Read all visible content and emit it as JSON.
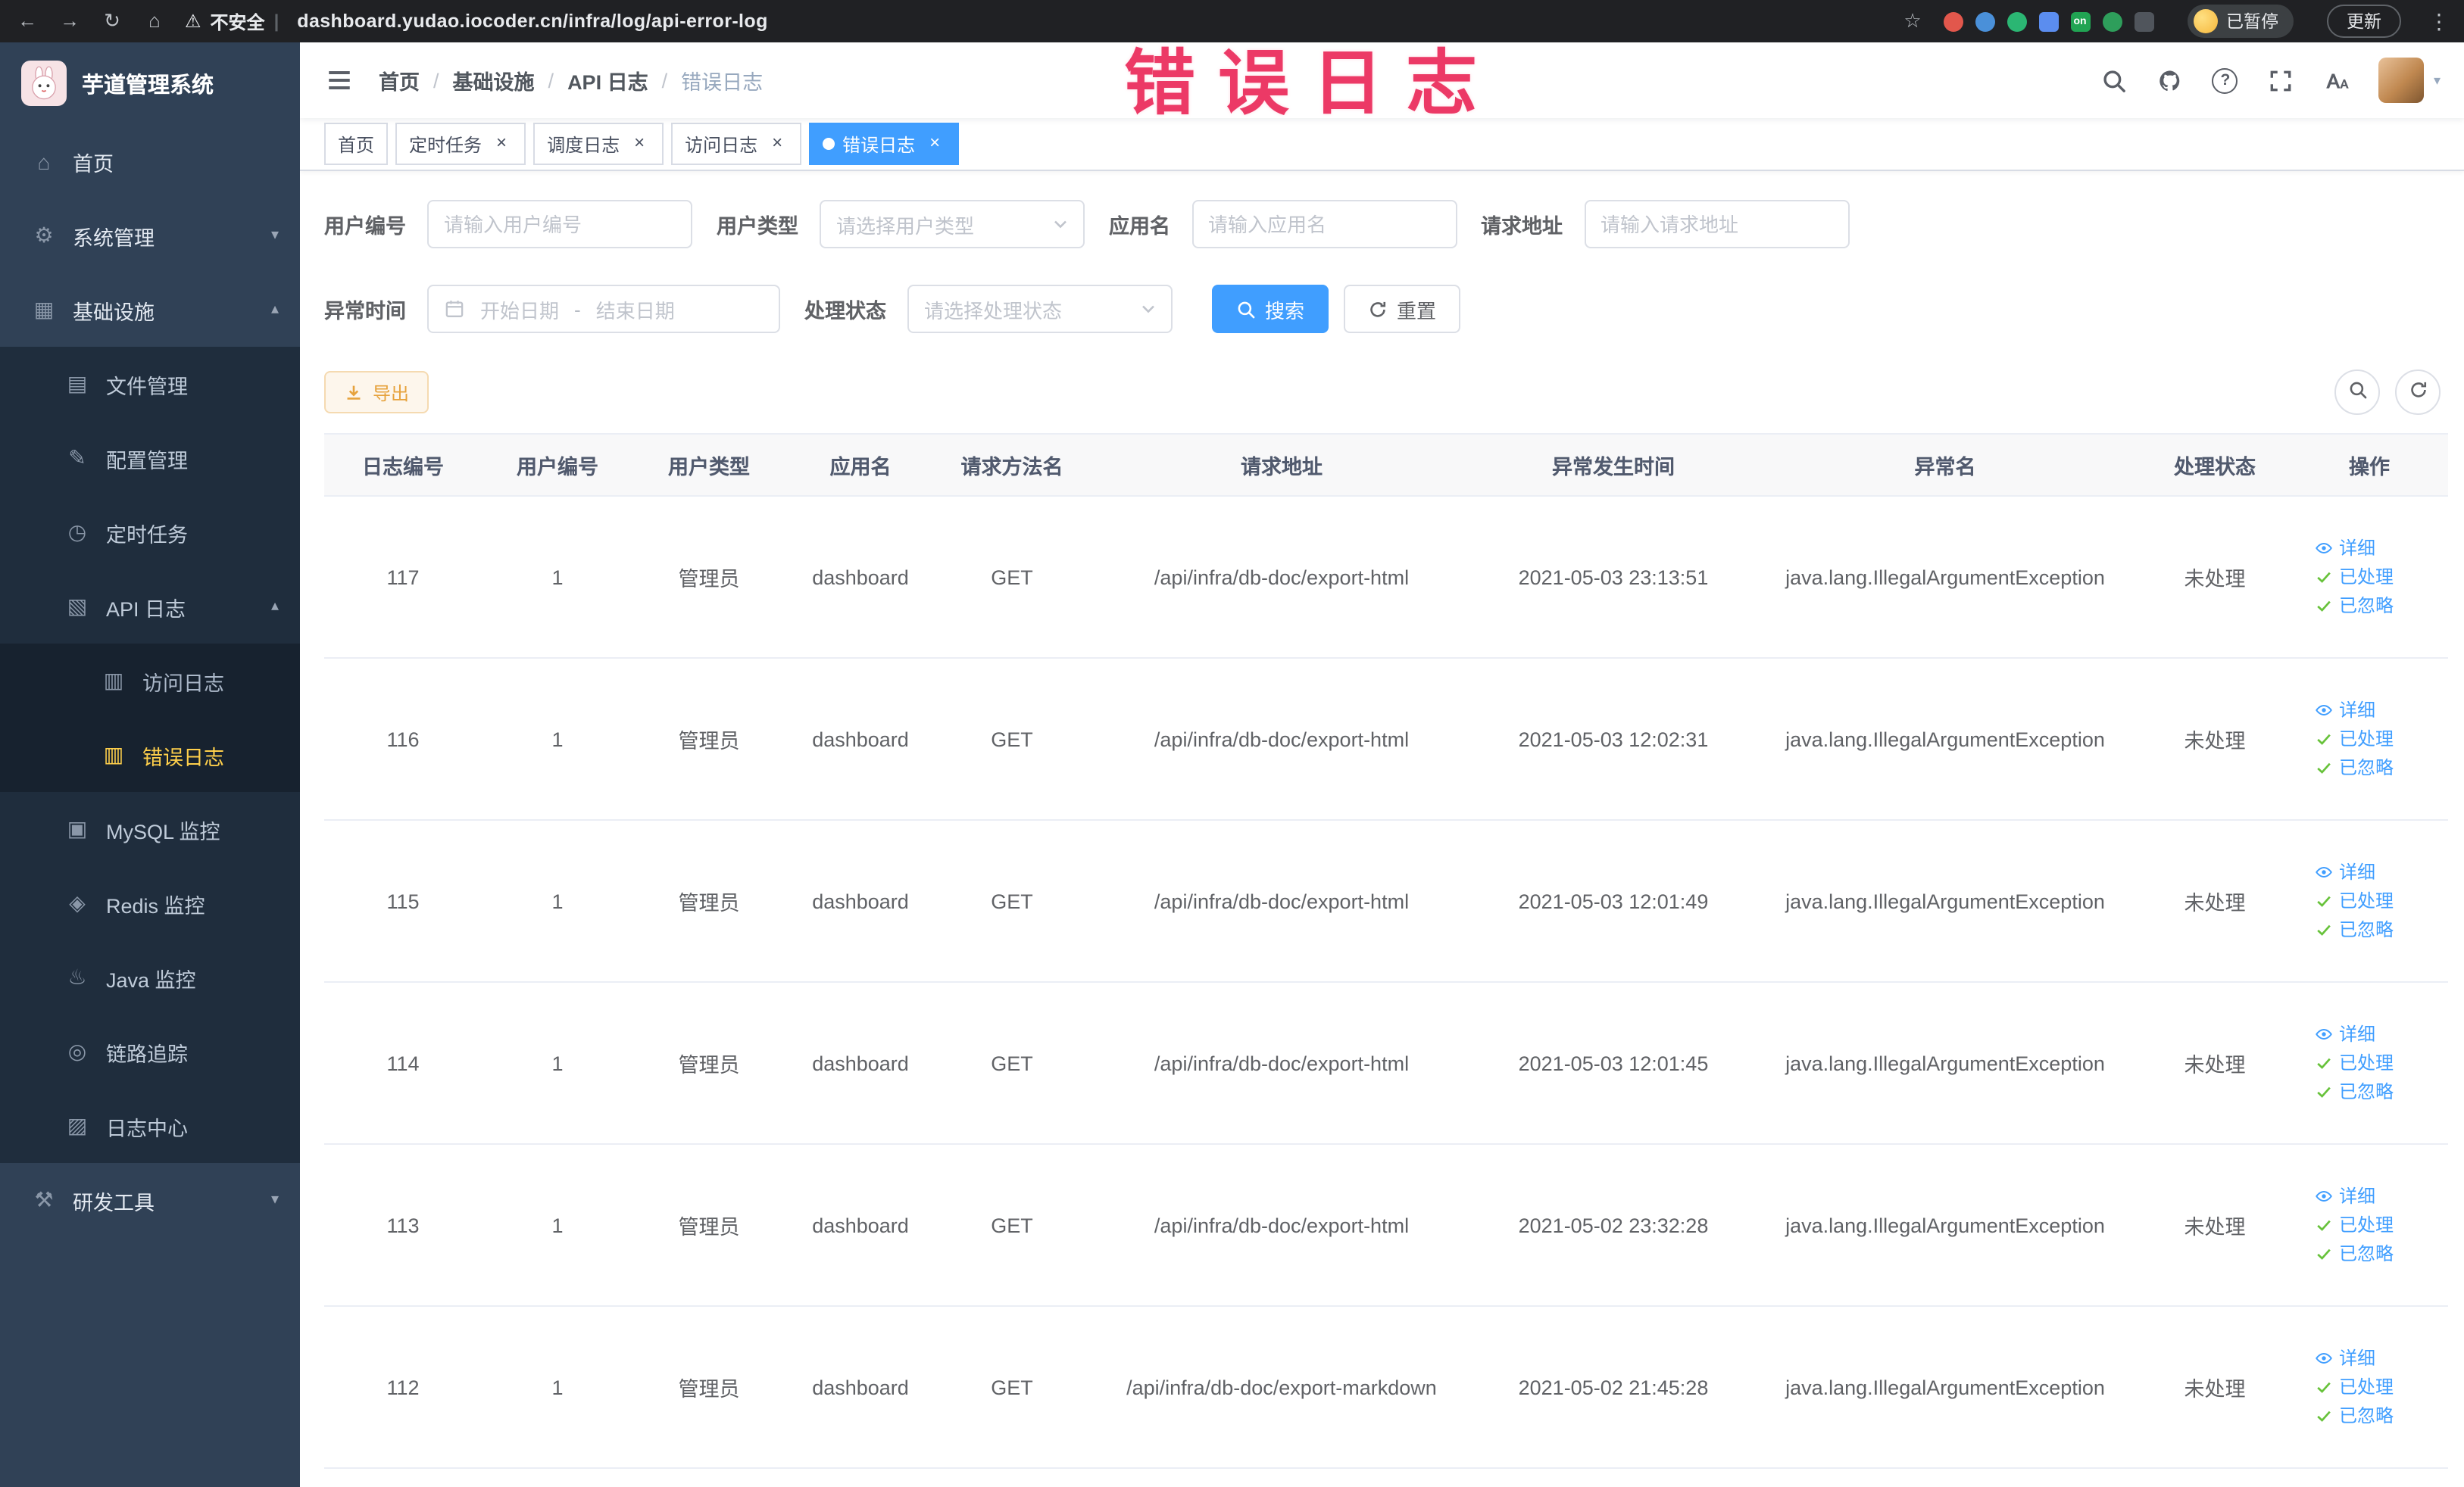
{
  "theme": {
    "accent": "#409eff",
    "menu_active_text": "#ffd04b",
    "watermark_color": "#ea2758"
  },
  "browser": {
    "security_label": "不安全",
    "url": "dashboard.yudao.iocoder.cn/infra/log/api-error-log",
    "extensions_badge": "on",
    "profile_label": "已暂停",
    "update_label": "更新"
  },
  "sidebar": {
    "logo_title": "芋道管理系统",
    "items": [
      {
        "key": "home",
        "label": "首页",
        "icon": "home-icon",
        "level": 1
      },
      {
        "key": "system",
        "label": "系统管理",
        "icon": "gear-icon",
        "level": 1,
        "chevron": "down"
      },
      {
        "key": "infra",
        "label": "基础设施",
        "icon": "infra-icon",
        "level": 1,
        "chevron": "up"
      },
      {
        "key": "file",
        "label": "文件管理",
        "icon": "file-icon",
        "level": 2
      },
      {
        "key": "config",
        "label": "配置管理",
        "icon": "config-icon",
        "level": 2
      },
      {
        "key": "job",
        "label": "定时任务",
        "icon": "job-icon",
        "level": 2
      },
      {
        "key": "api-log",
        "label": "API 日志",
        "icon": "api-log-icon",
        "level": 2,
        "chevron": "up"
      },
      {
        "key": "access-log",
        "label": "访问日志",
        "icon": "access-log-icon",
        "level": 3
      },
      {
        "key": "error-log",
        "label": "错误日志",
        "icon": "error-log-icon",
        "level": 3,
        "active": true
      },
      {
        "key": "mysql",
        "label": "MySQL 监控",
        "icon": "mysql-icon",
        "level": 2
      },
      {
        "key": "redis",
        "label": "Redis 监控",
        "icon": "redis-icon",
        "level": 2
      },
      {
        "key": "java",
        "label": "Java 监控",
        "icon": "java-icon",
        "level": 2
      },
      {
        "key": "trace",
        "label": "链路追踪",
        "icon": "trace-icon",
        "level": 2
      },
      {
        "key": "log-center",
        "label": "日志中心",
        "icon": "log-center-icon",
        "level": 2
      },
      {
        "key": "dev-tools",
        "label": "研发工具",
        "icon": "dev-tools-icon",
        "level": 1,
        "chevron": "down"
      }
    ]
  },
  "header": {
    "breadcrumb": [
      "首页",
      "基础设施",
      "API 日志",
      "错误日志"
    ],
    "watermark": "错误日志"
  },
  "tabs": [
    {
      "label": "首页",
      "closable": false,
      "active": false
    },
    {
      "label": "定时任务",
      "closable": true,
      "active": false
    },
    {
      "label": "调度日志",
      "closable": true,
      "active": false
    },
    {
      "label": "访问日志",
      "closable": true,
      "active": false
    },
    {
      "label": "错误日志",
      "closable": true,
      "active": true
    }
  ],
  "filters": {
    "user_id": {
      "label": "用户编号",
      "placeholder": "请输入用户编号"
    },
    "user_type": {
      "label": "用户类型",
      "placeholder": "请选择用户类型"
    },
    "app_name": {
      "label": "应用名",
      "placeholder": "请输入应用名"
    },
    "request_url": {
      "label": "请求地址",
      "placeholder": "请输入请求地址"
    },
    "exception_time": {
      "label": "异常时间",
      "start_placeholder": "开始日期",
      "separator": "-",
      "end_placeholder": "结束日期"
    },
    "process_status": {
      "label": "处理状态",
      "placeholder": "请选择处理状态"
    },
    "search_label": "搜索",
    "reset_label": "重置"
  },
  "toolbar": {
    "export_label": "导出"
  },
  "table": {
    "columns": [
      "日志编号",
      "用户编号",
      "用户类型",
      "应用名",
      "请求方法名",
      "请求地址",
      "异常发生时间",
      "异常名",
      "处理状态",
      "操作"
    ],
    "action_labels": {
      "detail": "详细",
      "processed": "已处理",
      "ignored": "已忽略"
    },
    "rows": [
      {
        "id": "117",
        "user_id": "1",
        "user_type": "管理员",
        "app_name": "dashboard",
        "method": "GET",
        "url": "/api/infra/db-doc/export-html",
        "time": "2021-05-03 23:13:51",
        "exception": "java.lang.IllegalArgumentException",
        "status": "未处理"
      },
      {
        "id": "116",
        "user_id": "1",
        "user_type": "管理员",
        "app_name": "dashboard",
        "method": "GET",
        "url": "/api/infra/db-doc/export-html",
        "time": "2021-05-03 12:02:31",
        "exception": "java.lang.IllegalArgumentException",
        "status": "未处理"
      },
      {
        "id": "115",
        "user_id": "1",
        "user_type": "管理员",
        "app_name": "dashboard",
        "method": "GET",
        "url": "/api/infra/db-doc/export-html",
        "time": "2021-05-03 12:01:49",
        "exception": "java.lang.IllegalArgumentException",
        "status": "未处理"
      },
      {
        "id": "114",
        "user_id": "1",
        "user_type": "管理员",
        "app_name": "dashboard",
        "method": "GET",
        "url": "/api/infra/db-doc/export-html",
        "time": "2021-05-03 12:01:45",
        "exception": "java.lang.IllegalArgumentException",
        "status": "未处理"
      },
      {
        "id": "113",
        "user_id": "1",
        "user_type": "管理员",
        "app_name": "dashboard",
        "method": "GET",
        "url": "/api/infra/db-doc/export-html",
        "time": "2021-05-02 23:32:28",
        "exception": "java.lang.IllegalArgumentException",
        "status": "未处理"
      },
      {
        "id": "112",
        "user_id": "1",
        "user_type": "管理员",
        "app_name": "dashboard",
        "method": "GET",
        "url": "/api/infra/db-doc/export-markdown",
        "time": "2021-05-02 21:45:28",
        "exception": "java.lang.IllegalArgumentException",
        "status": "未处理"
      }
    ]
  }
}
